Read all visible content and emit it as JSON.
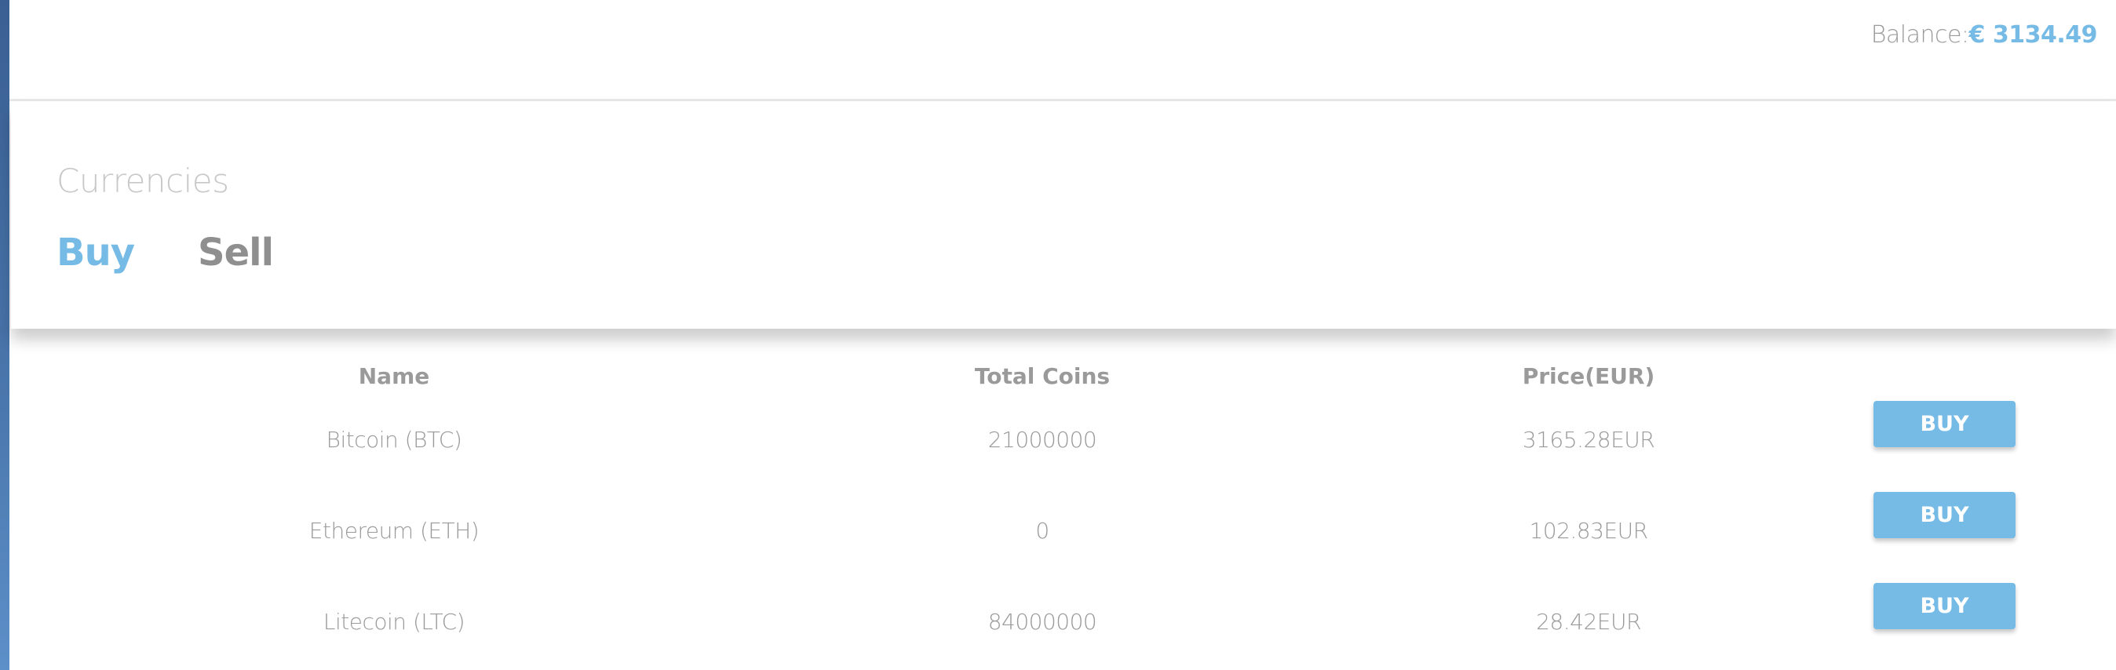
{
  "header": {
    "balance_label": "Balance:",
    "balance_value": "€ 3134.49"
  },
  "panel": {
    "title": "Currencies",
    "tabs": [
      {
        "label": "Buy",
        "active": true
      },
      {
        "label": "Sell",
        "active": false
      }
    ]
  },
  "table": {
    "columns": [
      "Name",
      "Total Coins",
      "Price(EUR)"
    ],
    "rows": [
      {
        "name": "Bitcoin (BTC)",
        "total_coins": "21000000",
        "price": "3165.28EUR",
        "action": "BUY"
      },
      {
        "name": "Ethereum (ETH)",
        "total_coins": "0",
        "price": "102.83EUR",
        "action": "BUY"
      },
      {
        "name": "Litecoin (LTC)",
        "total_coins": "84000000",
        "price": "28.42EUR",
        "action": "BUY"
      }
    ]
  },
  "colors": {
    "accent": "#76bbe6",
    "text_muted": "#9a9a9a",
    "sidebar_edge": "#4a77ad"
  }
}
